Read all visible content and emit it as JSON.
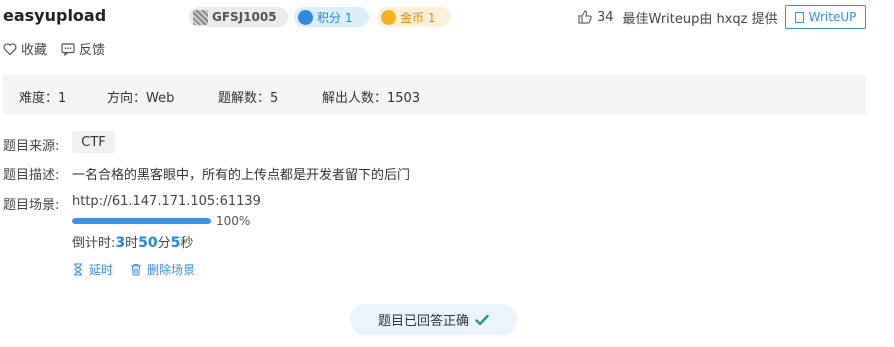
{
  "challenge": {
    "title": "easyupload",
    "tags": {
      "id": "GFSJ1005",
      "score_label": "积分 1",
      "coin_label": "金币 1"
    }
  },
  "header_right": {
    "likes": "34",
    "best_writeup": "最佳Writeup由 hxqz 提供",
    "writeup_button": "WriteUP"
  },
  "actions": {
    "favorite": "收藏",
    "feedback": "反馈"
  },
  "stats": {
    "difficulty": "难度：1",
    "direction": "方向：Web",
    "solves": "题解数：5",
    "solvers": "解出人数：1503"
  },
  "details": {
    "source_label": "题目来源:",
    "source_value": "CTF",
    "desc_label": "题目描述:",
    "desc_value": "一名合格的黑客眼中，所有的上传点都是开发者留下的后门",
    "scene_label": "题目场景:",
    "scene_url": "http://61.147.171.105:61139",
    "progress_text": "100%",
    "progress_fraction": 1.0,
    "countdown": {
      "prefix": "倒计时: ",
      "hours": "3",
      "hours_unit": "时",
      "minutes": "50",
      "minutes_unit": "分",
      "seconds": "5",
      "seconds_unit": "秒"
    },
    "delay_label": "延时",
    "delete_label": "删除场景"
  },
  "status": {
    "solved_text": "题目已回答正确"
  },
  "colors": {
    "accent": "#3a8ee6",
    "success": "#22a35a"
  }
}
